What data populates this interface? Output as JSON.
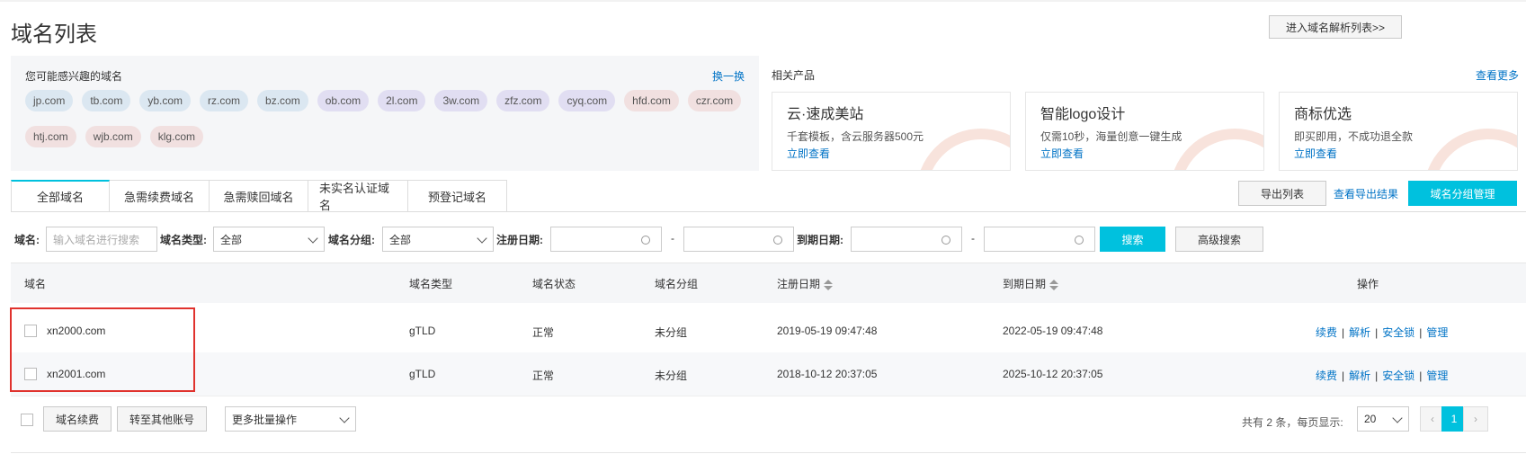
{
  "page": {
    "title": "域名列表",
    "goto_dns_label": "进入域名解析列表>>"
  },
  "suggest": {
    "header": "您可能感兴趣的域名",
    "swap_label": "换一换",
    "tags": [
      "jp.com",
      "tb.com",
      "yb.com",
      "rz.com",
      "bz.com",
      "ob.com",
      "2l.com",
      "3w.com",
      "zfz.com",
      "cyq.com",
      "hfd.com",
      "czr.com",
      "htj.com",
      "wjb.com",
      "klg.com"
    ]
  },
  "related": {
    "header": "相关产品",
    "more_label": "查看更多",
    "cards": [
      {
        "title": "云·速成美站",
        "desc": "千套模板，含云服务器500元",
        "link": "立即查看"
      },
      {
        "title": "智能logo设计",
        "desc": "仅需10秒，海量创意一键生成",
        "link": "立即查看"
      },
      {
        "title": "商标优选",
        "desc": "即买即用，不成功退全款",
        "link": "立即查看"
      }
    ]
  },
  "tabs": [
    "全部域名",
    "急需续费域名",
    "急需赎回域名",
    "未实名认证域名",
    "预登记域名"
  ],
  "toolbar": {
    "export_label": "导出列表",
    "export_result_label": "查看导出结果",
    "group_manage_label": "域名分组管理"
  },
  "filters": {
    "domain_label": "域名:",
    "domain_placeholder": "输入域名进行搜索",
    "type_label": "域名类型:",
    "type_value": "全部",
    "group_label": "域名分组:",
    "group_value": "全部",
    "reg_label": "注册日期:",
    "exp_label": "到期日期:",
    "dash": "-",
    "search_label": "搜索",
    "advanced_label": "高级搜索"
  },
  "table": {
    "headers": {
      "domain": "域名",
      "type": "域名类型",
      "status": "域名状态",
      "group": "域名分组",
      "reg": "注册日期",
      "exp": "到期日期",
      "ops": "操作"
    },
    "ops": [
      "续费",
      "解析",
      "安全锁",
      "管理"
    ],
    "op_sep": "|",
    "rows": [
      {
        "domain": "xn2000.com",
        "type": "gTLD",
        "status": "正常",
        "group": "未分组",
        "reg": "2019-05-19 09:47:48",
        "exp": "2022-05-19 09:47:48"
      },
      {
        "domain": "xn2001.com",
        "type": "gTLD",
        "status": "正常",
        "group": "未分组",
        "reg": "2018-10-12 20:37:05",
        "exp": "2025-10-12 20:37:05"
      }
    ]
  },
  "footer": {
    "renew_label": "域名续费",
    "transfer_label": "转至其他账号",
    "batch_label": "更多批量操作",
    "total_text": "共有 2 条，每页显示:",
    "page_size": "20",
    "prev": "‹",
    "current_page": "1",
    "next": "›"
  },
  "colors": {
    "accent": "#00c1de",
    "link": "#0073c6",
    "highlight": "#e0322d"
  }
}
